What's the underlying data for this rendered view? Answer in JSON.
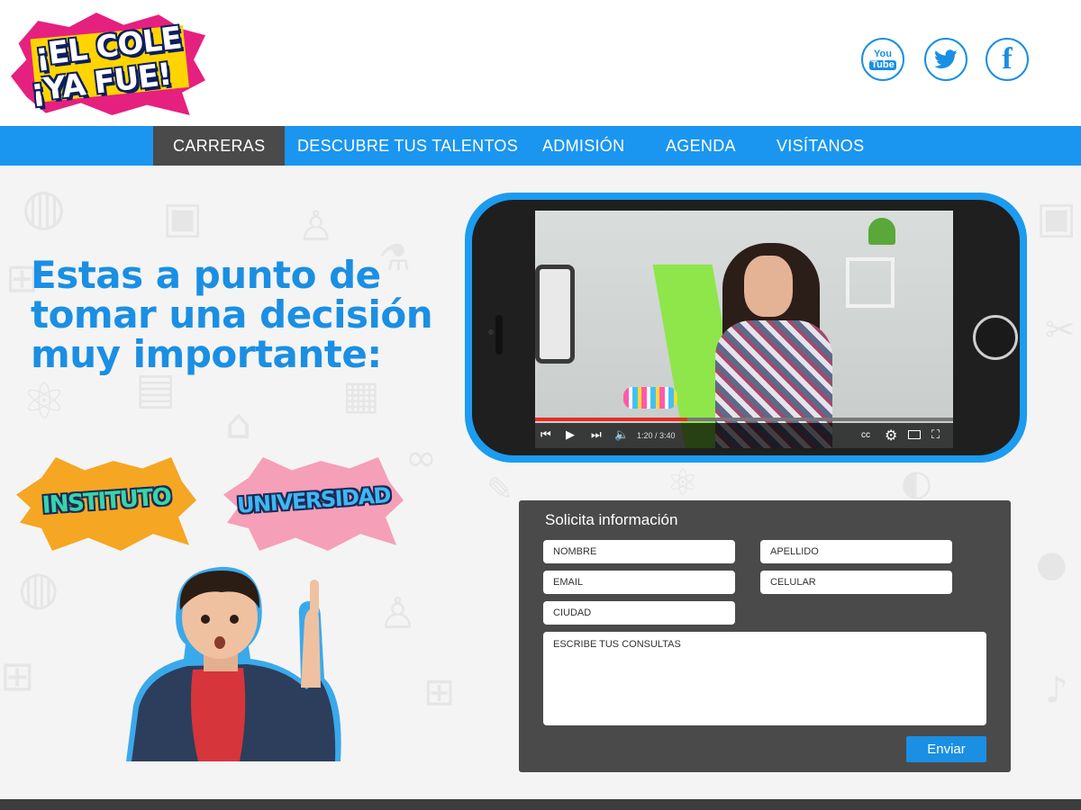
{
  "brand": {
    "logo_line1": "¡EL COLE",
    "logo_line2": "¡YA FUE!",
    "colors": {
      "primary_blue": "#1a96f0",
      "nav_active": "#4a4a4a",
      "logo_pink": "#e6207f",
      "logo_yellow": "#ffd400"
    }
  },
  "social": {
    "youtube": {
      "icon": "youtube-icon",
      "you": "You",
      "tube": "Tube"
    },
    "twitter": {
      "icon": "twitter-icon"
    },
    "facebook": {
      "icon": "facebook-icon",
      "glyph": "f"
    }
  },
  "nav": {
    "items": [
      {
        "label": "CARRERAS",
        "active": true
      },
      {
        "label": "DESCUBRE TUS TALENTOS",
        "active": false
      },
      {
        "label": "ADMISIÓN",
        "active": false
      },
      {
        "label": "AGENDA",
        "active": false
      },
      {
        "label": "VISÍTANOS",
        "active": false
      }
    ]
  },
  "hero": {
    "headline": "Estas a punto de tomar una decisión muy importante:"
  },
  "badges": {
    "instituto": "INSTITUTO",
    "universidad": "UNIVERSIDAD"
  },
  "video": {
    "time": "1:20 / 3:40",
    "progress_fraction": 0.364,
    "controls": {
      "prev": "⏮",
      "play": "▶",
      "next": "⏭",
      "volume": "🔈",
      "cc": "cc",
      "settings": "⚙",
      "fullscreen": "⛶"
    }
  },
  "form": {
    "title": "Solicita información",
    "fields": {
      "nombre": "NOMBRE",
      "apellido": "APELLIDO",
      "email": "EMAIL",
      "celular": "CELULAR",
      "ciudad": "CIUDAD",
      "consultas": "ESCRIBE TUS CONSULTAS"
    },
    "submit_label": "Enviar"
  }
}
